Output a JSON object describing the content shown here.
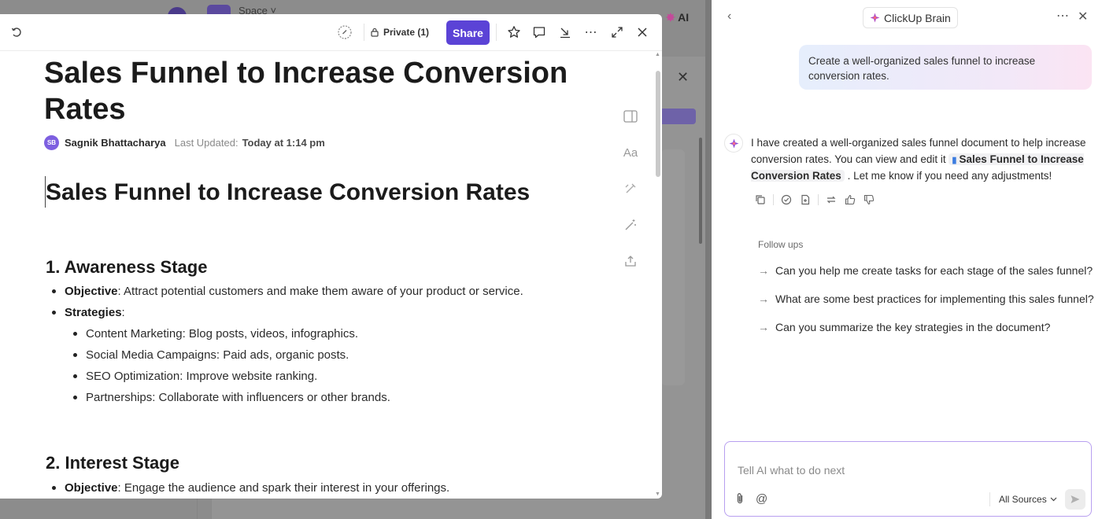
{
  "background": {
    "space_label": "Space ˅",
    "ai_label": "AI"
  },
  "toolbar": {
    "private_label": "Private (1)",
    "share_label": "Share"
  },
  "doc": {
    "title": "Sales Funnel to Increase Conversion Rates",
    "author_initials": "SB",
    "author": "Sagnik Bhattacharya",
    "last_updated_label": "Last Updated:",
    "last_updated_value": "Today at 1:14 pm",
    "heading": "Sales Funnel to Increase Conversion Rates",
    "sections": [
      {
        "title": "1. Awareness Stage",
        "objective_label": "Objective",
        "objective_text": ": Attract potential customers and make them aware of your product or service.",
        "strategies_label": "Strategies",
        "strategies_suffix": ":",
        "strategies": [
          "Content Marketing: Blog posts, videos, infographics.",
          "Social Media Campaigns: Paid ads, organic posts.",
          "SEO Optimization: Improve website ranking.",
          "Partnerships: Collaborate with influencers or other brands."
        ]
      },
      {
        "title": "2. Interest Stage",
        "objective_label": "Objective",
        "objective_text": ": Engage the audience and spark their interest in your offerings."
      }
    ]
  },
  "brain": {
    "title": "ClickUp Brain",
    "user_prompt": "Create a well-organized sales funnel to increase conversion rates.",
    "ai_response_before": "I have created a well-organized sales funnel document to help increase conversion rates. You can view and edit it",
    "ai_doc_link": "Sales Funnel to Increase Conversion Rates",
    "ai_response_after": ". Let me know if you need any adjustments!",
    "followups_label": "Follow ups",
    "followups": [
      "Can you help me create tasks for each stage of the sales funnel?",
      "What are some best practices for implementing this sales funnel?",
      "Can you summarize the key strategies in the document?"
    ],
    "input_placeholder": "Tell AI what to do next",
    "sources_label": "All Sources"
  },
  "colors": {
    "share_button": "#5b43d6",
    "input_border": "#b89ff0",
    "doc_link_icon": "#3b7ce0"
  },
  "icons": [
    "refresh-icon",
    "tag-icon",
    "lock-icon",
    "star-icon",
    "comment-icon",
    "collapse-icon",
    "more-icon",
    "expand-icon",
    "close-icon",
    "sidebar-icon",
    "font-icon",
    "ai-pen-icon",
    "magic-wand-icon",
    "export-icon",
    "copy-icon",
    "check-circle-icon",
    "save-icon",
    "retry-icon",
    "thumbs-up-icon",
    "thumbs-down-icon",
    "paperclip-icon",
    "at-icon",
    "send-icon",
    "brain-logo-icon",
    "back-arrow-icon"
  ]
}
